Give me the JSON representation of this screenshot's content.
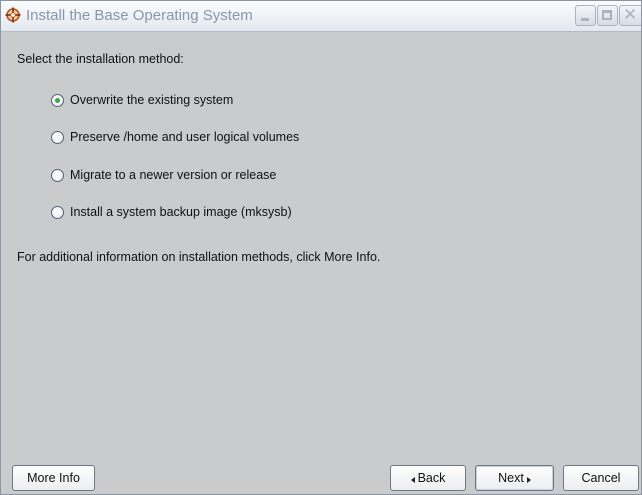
{
  "window": {
    "title": "Install the Base Operating System",
    "icon": "crosshair-globe-icon"
  },
  "prompt": "Select the installation method:",
  "options": [
    {
      "label": "Overwrite the existing system",
      "selected": true
    },
    {
      "label": "Preserve /home and user logical volumes",
      "selected": false
    },
    {
      "label": "Migrate to a newer version or release",
      "selected": false
    },
    {
      "label": "Install a system backup image (mksysb)",
      "selected": false
    }
  ],
  "info_text": "For additional information on installation methods, click More Info.",
  "buttons": {
    "more_info": "More Info",
    "back": "Back",
    "next": "Next",
    "cancel": "Cancel"
  },
  "colors": {
    "background": "#c9cbcd",
    "title_text": "#8a97a8",
    "radio_selected": "#3aa83a",
    "title_icon": "#b35a1e"
  }
}
